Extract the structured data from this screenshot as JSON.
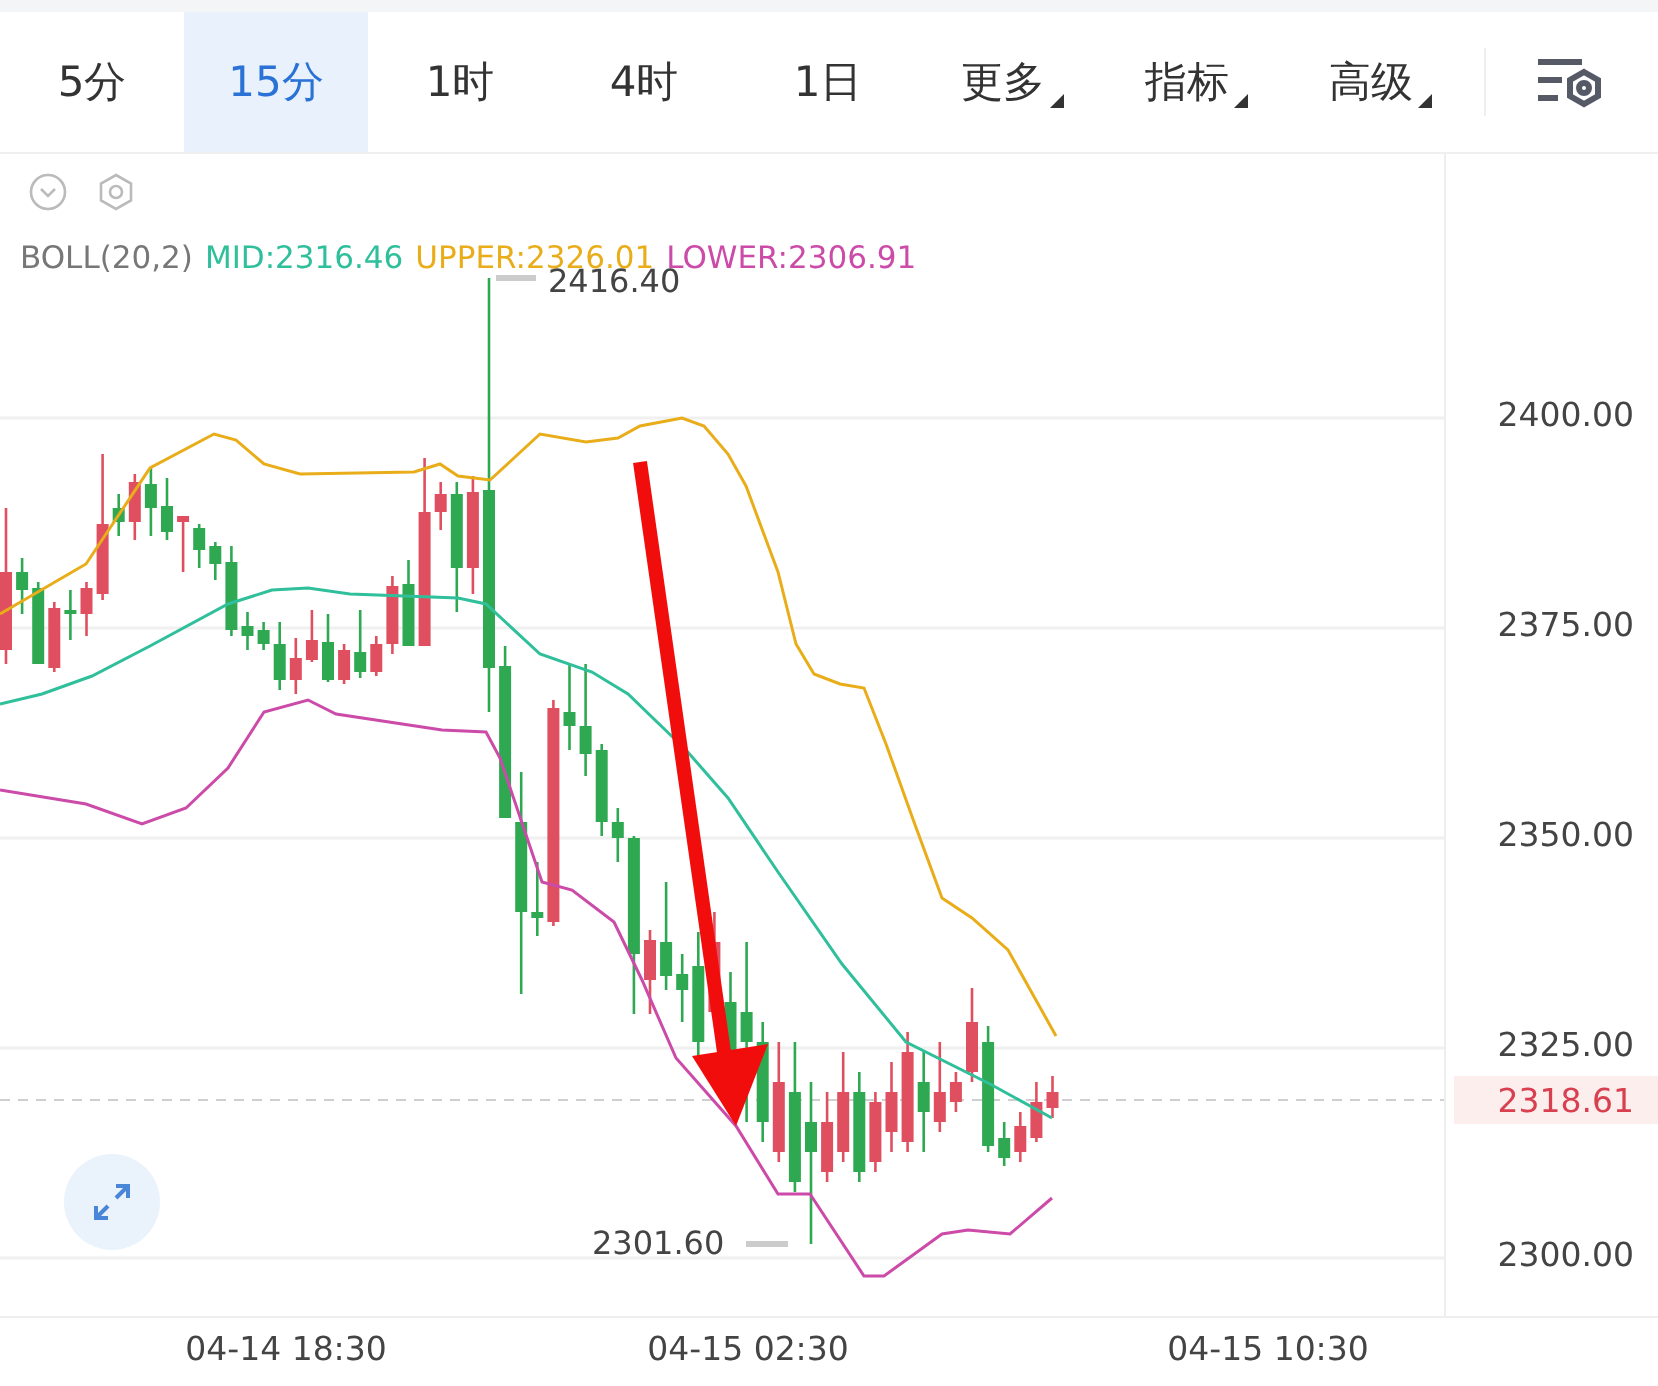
{
  "tabs": [
    {
      "label": "5分",
      "selected": false,
      "kind": "plain"
    },
    {
      "label": "15分",
      "selected": true,
      "kind": "plain"
    },
    {
      "label": "1时",
      "selected": false,
      "kind": "plain"
    },
    {
      "label": "4时",
      "selected": false,
      "kind": "plain"
    },
    {
      "label": "1日",
      "selected": false,
      "kind": "plain"
    },
    {
      "label": "更多",
      "selected": false,
      "kind": "dropdown"
    },
    {
      "label": "指标",
      "selected": false,
      "kind": "dropdown"
    },
    {
      "label": "高级",
      "selected": false,
      "kind": "dropdown"
    }
  ],
  "indicator": {
    "name": "BOLL(20,2)",
    "mid": "MID:2316.46",
    "upper": "UPPER:2326.01",
    "lower": "LOWER:2306.91"
  },
  "high_marker": "2416.40",
  "low_marker": "2301.60",
  "price_axis": [
    "2400.00",
    "2375.00",
    "2350.00",
    "2325.00",
    "2300.00"
  ],
  "current_price": "2318.61",
  "time_axis": [
    "04-14 18:30",
    "04-15 02:30",
    "04-15 10:30"
  ]
}
